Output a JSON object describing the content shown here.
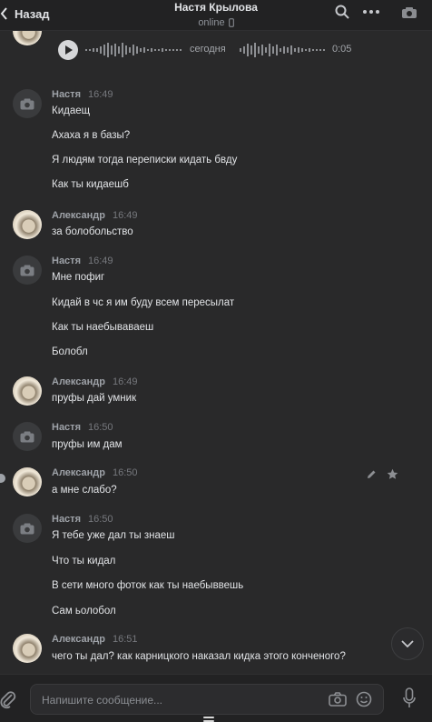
{
  "header": {
    "back_label": "Назад",
    "contact_name": "Настя Крылова",
    "status": "online",
    "icons": [
      "chevron-left-icon",
      "search-icon",
      "more-icon",
      "camera-icon"
    ]
  },
  "voice_message": {
    "date_label": "сегодня",
    "duration": "0:05"
  },
  "messages": [
    {
      "name": "Настя",
      "time": "16:49",
      "lines": [
        "Кидаещ",
        "Ахаха я в базы?",
        "Я людям тогда переписки кидать бвду",
        "Как ты кидаешб"
      ]
    },
    {
      "name": "Александр",
      "time": "16:49",
      "lines": [
        "за болобольство"
      ]
    },
    {
      "name": "Настя",
      "time": "16:49",
      "lines": [
        "Мне пофиг",
        "Кидай в чс я им буду всем пересылат",
        "Как ты наебываваеш",
        "Болобл"
      ]
    },
    {
      "name": "Александр",
      "time": "16:49",
      "lines": [
        "пруфы дай умник"
      ]
    },
    {
      "name": "Настя",
      "time": "16:50",
      "lines": [
        "пруфы им дам"
      ]
    },
    {
      "name": "Александр",
      "time": "16:50",
      "lines": [
        "а мне слабо?"
      ]
    },
    {
      "name": "Настя",
      "time": "16:50",
      "lines": [
        "Я тебе уже дал ты знаеш",
        "Что ты кидал",
        "В сети много фоток как ты наебыввешь",
        "Сам ьолобол"
      ]
    },
    {
      "name": "Александр",
      "time": "16:51",
      "lines": [
        "чего ты дал? как карницкого наказал кидка этого конченого?"
      ]
    }
  ],
  "composer": {
    "placeholder": "Напишите сообщение..."
  },
  "colors": {
    "background": "#29292a",
    "header": "#222223",
    "text": "#e1e3e6",
    "muted": "#8f939a"
  }
}
